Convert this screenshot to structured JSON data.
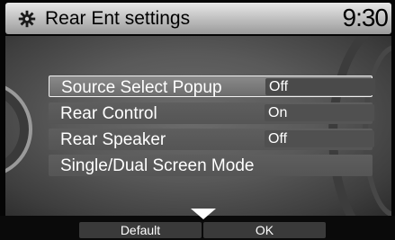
{
  "header": {
    "icon": "gear-icon",
    "title": "Rear Ent settings",
    "clock": "9:30"
  },
  "settings": [
    {
      "label": "Source Select Popup",
      "value": "Off"
    },
    {
      "label": "Rear Control",
      "value": "On"
    },
    {
      "label": "Rear Speaker",
      "value": "Off"
    },
    {
      "label": "Single/Dual Screen Mode",
      "value": ""
    }
  ],
  "softkeys": {
    "default_label": "Default",
    "ok_label": "OK"
  },
  "colors": {
    "header_bg": "#cfcfcf",
    "panel_bg": "#595959",
    "highlight_border": "#f2f2f2"
  }
}
